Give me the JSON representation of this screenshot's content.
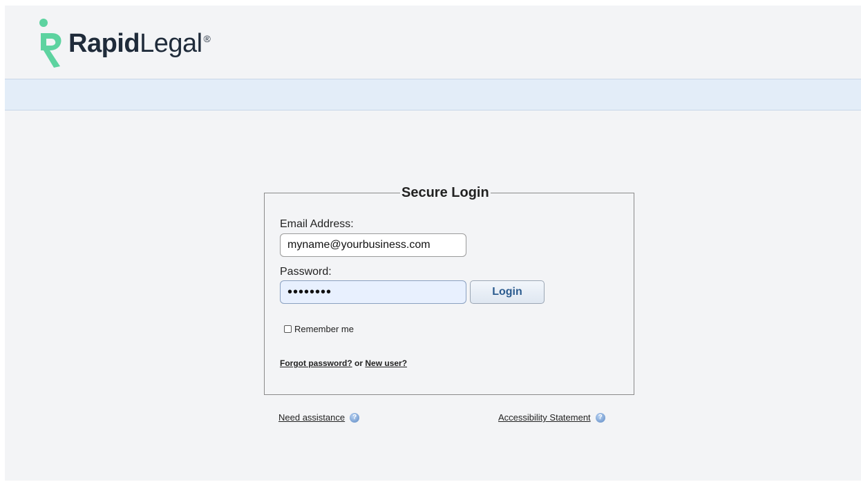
{
  "header": {
    "brand_bold": "Rapid",
    "brand_light": "Legal",
    "registered_mark": "®",
    "accent_color": "#5dd3a0"
  },
  "login": {
    "title": "Secure Login",
    "email_label": "Email Address:",
    "email_value": "myname@yourbusiness.com",
    "password_label": "Password:",
    "password_value": "••••••••",
    "login_button": "Login",
    "remember_label": "Remember me",
    "remember_checked": false,
    "forgot_link": "Forgot password?",
    "or_text": "or",
    "new_user_link": "New user?"
  },
  "footer_links": {
    "need_assistance": "Need assistance",
    "accessibility": "Accessibility Statement",
    "help_icon": "help-circle-icon"
  }
}
